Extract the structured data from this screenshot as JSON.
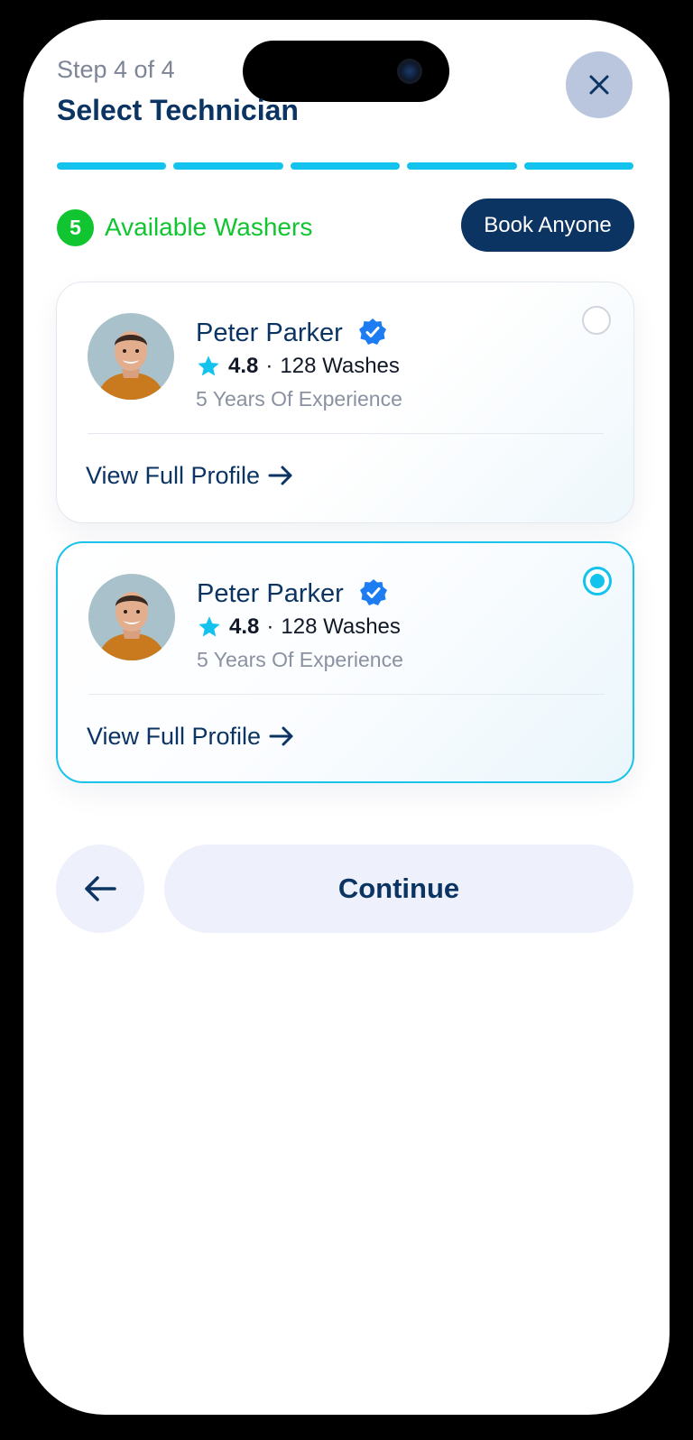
{
  "header": {
    "step_label": "Step 4 of 4",
    "title": "Select Technician",
    "close_icon": "close-icon"
  },
  "progress": {
    "segments": 5,
    "filled": 5,
    "color": "#13c3ee"
  },
  "availability": {
    "count": "5",
    "label": "Available Washers",
    "color": "#11c531",
    "book_anyone_label": "Book Anyone"
  },
  "technicians": [
    {
      "name": "Peter Parker",
      "verified": true,
      "rating": "4.8",
      "separator": "·",
      "washes": "128 Washes",
      "experience": "5 Years Of Experience",
      "link_label": "View Full Profile",
      "selected": false
    },
    {
      "name": "Peter Parker",
      "verified": true,
      "rating": "4.8",
      "separator": "·",
      "washes": "128 Washes",
      "experience": "5 Years Of Experience",
      "link_label": "View Full Profile",
      "selected": true
    }
  ],
  "footer": {
    "back_icon": "arrow-left-icon",
    "continue_label": "Continue"
  },
  "colors": {
    "brand_navy": "#0b3463",
    "accent_cyan": "#13c3ee",
    "success_green": "#11c531",
    "button_bg": "#eef1fb"
  }
}
